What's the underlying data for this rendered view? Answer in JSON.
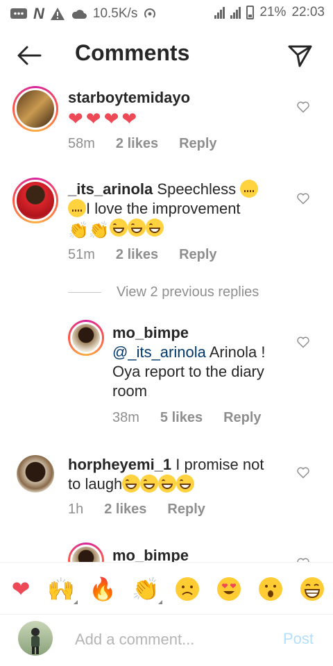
{
  "status_bar": {
    "speed": "10.5K/s",
    "battery": "21%",
    "time": "22:03"
  },
  "header": {
    "title": "Comments"
  },
  "comments": [
    {
      "username": "starboytemidayo",
      "text": "",
      "emoji": [
        "heart-emoji",
        "heart-emoji",
        "heart-emoji",
        "heart-emoji"
      ],
      "time": "58m",
      "likes": "2 likes",
      "reply": "Reply"
    },
    {
      "username": "_its_arinola",
      "text_part1": "Speechless ",
      "text_part2": "I love the improvement",
      "time": "51m",
      "likes": "2 likes",
      "reply": "Reply"
    },
    {
      "username": "horpheyemi_1",
      "text_part1": "I promise not",
      "text_part2": "to laugh",
      "time": "1h",
      "likes": "2 likes",
      "reply": "Reply"
    }
  ],
  "view_previous": "View 2 previous replies",
  "replies": [
    {
      "username": "mo_bimpe",
      "mention": "@_its_arinola",
      "text_line1": " Arinola !",
      "text_line2": "Oya report to the diary",
      "text_line3": "room",
      "time": "38m",
      "likes": "5 likes",
      "reply": "Reply"
    },
    {
      "username": "mo_bimpe"
    }
  ],
  "emoji_bar": [
    "heart",
    "raised-hands",
    "fire",
    "clapping-hands",
    "sad-face",
    "heart-eyes-face",
    "surprised-face",
    "grinning-face"
  ],
  "emoji_glyphs": {
    "heart": "❤",
    "raised_hands": "🙌",
    "fire": "🔥",
    "clap": "👏"
  },
  "add_comment": {
    "placeholder": "Add a comment...",
    "post_label": "Post"
  },
  "colors": {
    "accent_heart": "#ed4956",
    "link": "#00376b",
    "muted": "#8e8e8e",
    "post_disabled": "#b2dffc"
  }
}
